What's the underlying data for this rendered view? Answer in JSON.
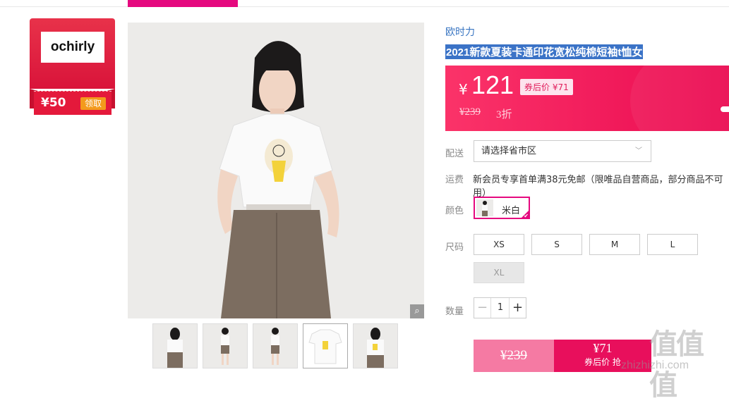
{
  "store": {
    "logo": "ochirly",
    "coupon_amount": "¥50",
    "coupon_button": "领取"
  },
  "product": {
    "brand": "欧时力",
    "title": "2021新款夏装卡通印花宽松纯棉短袖t恤女"
  },
  "price": {
    "currency": "¥",
    "value": "121",
    "after_coupon": "券后价 ¥71",
    "original": "¥239",
    "discount": "3折"
  },
  "labels": {
    "delivery": "配送",
    "freight": "运费",
    "color": "颜色",
    "size": "尺码",
    "quantity": "数量"
  },
  "delivery": {
    "placeholder": "请选择省市区"
  },
  "freight_text": "新会员专享首单满38元免邮（限唯品自营商品，部分商品不可用）",
  "colors": [
    {
      "name": "米白",
      "selected": true
    }
  ],
  "sizes": [
    {
      "label": "XS",
      "available": true
    },
    {
      "label": "S",
      "available": true
    },
    {
      "label": "M",
      "available": true
    },
    {
      "label": "L",
      "available": true
    },
    {
      "label": "XL",
      "available": false
    }
  ],
  "quantity": {
    "value": "1",
    "minus": "−",
    "plus": "+"
  },
  "buy": {
    "original_price": "¥239",
    "coupon_price": "¥71",
    "coupon_label": "券后价 抢"
  },
  "watermark": {
    "chars": "值值值",
    "url": "zhizhizhi.com"
  },
  "colors_palette": {
    "accent": "#e5097f",
    "price_bg": "#f0245e",
    "store_red": "#e4193b"
  },
  "icons": {
    "zoom": "magnifier-icon",
    "dropdown": "chevron-down-icon",
    "check": "check-icon"
  }
}
